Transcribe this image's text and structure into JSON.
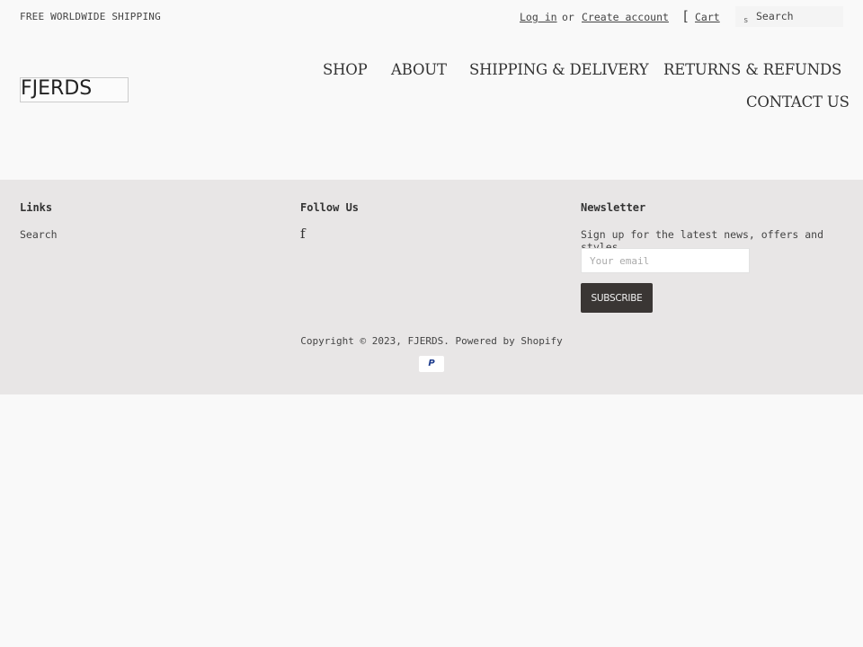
{
  "announcement": "FREE WORLDWIDE SHIPPING",
  "header": {
    "login": "Log in",
    "or": "or",
    "create_account": "Create account",
    "cart_icon": "[",
    "cart": "Cart",
    "search_icon": "s",
    "search_placeholder": "Search"
  },
  "logo": "FJERDS",
  "nav": [
    "SHOP",
    "ABOUT",
    "SHIPPING & DELIVERY",
    "RETURNS & REFUNDS",
    "CONTACT US"
  ],
  "footer": {
    "links_heading": "Links",
    "links": [
      "Search"
    ],
    "follow_heading": "Follow Us",
    "facebook_icon": "f",
    "newsletter_heading": "Newsletter",
    "newsletter_text": "Sign up for the latest news, offers and styles",
    "email_placeholder": "Your email",
    "subscribe": "SUBSCRIBE",
    "copyright_prefix": "Copyright © 2023, ",
    "copyright_brand": "FJERDS",
    "copyright_sep": ". ",
    "powered_by": "Powered by Shopify",
    "payment_icon": "P"
  }
}
